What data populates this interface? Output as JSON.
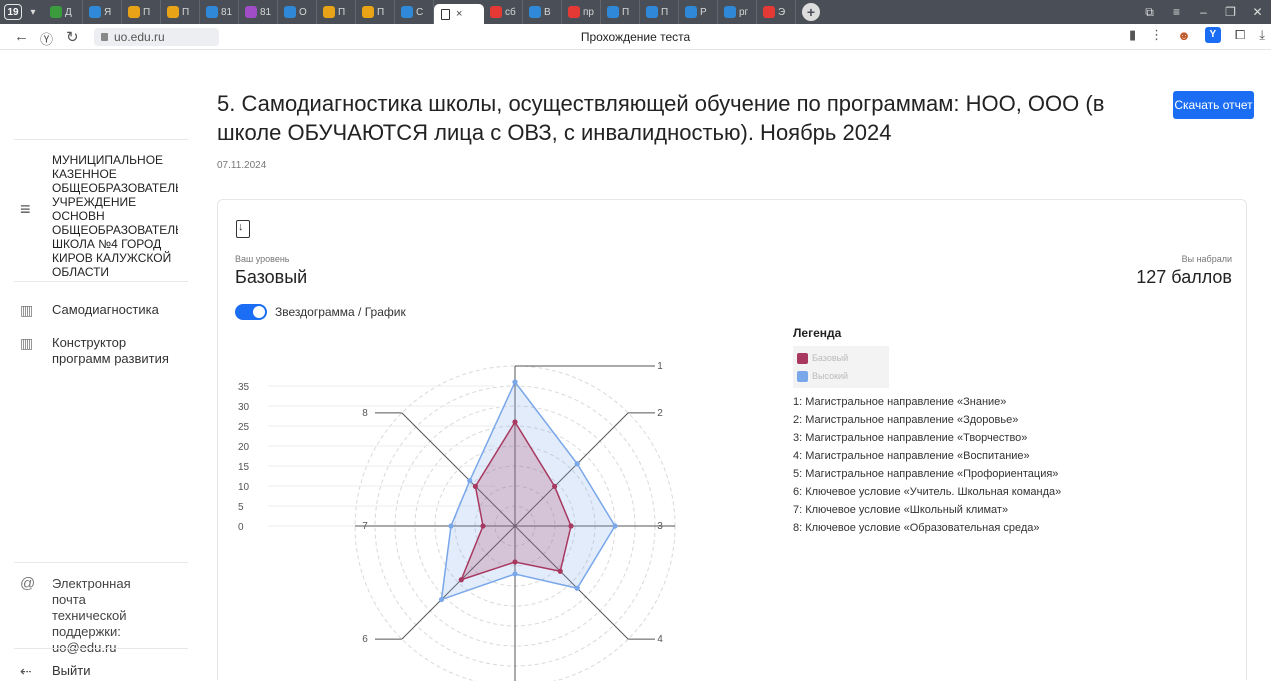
{
  "browser": {
    "tab_count": "19",
    "tabs": [
      {
        "label": "Д",
        "color": "#3a9c3d"
      },
      {
        "label": "Я",
        "color": "#2f88d8"
      },
      {
        "label": "П",
        "color": "#e8a317"
      },
      {
        "label": "П",
        "color": "#e8a317"
      },
      {
        "label": "81",
        "color": "#2f88d8"
      },
      {
        "label": "81",
        "color": "#a04dc7"
      },
      {
        "label": "О",
        "color": "#2f88d8"
      },
      {
        "label": "П",
        "color": "#e8a317"
      },
      {
        "label": "П",
        "color": "#e8a317"
      },
      {
        "label": "С",
        "color": "#2f88d8"
      }
    ],
    "tabs_after": [
      {
        "label": "сб",
        "color": "#e53935"
      },
      {
        "label": "В",
        "color": "#2f88d8"
      },
      {
        "label": "пр",
        "color": "#e53935"
      },
      {
        "label": "П",
        "color": "#2f88d8"
      },
      {
        "label": "П",
        "color": "#2f88d8"
      },
      {
        "label": "Р",
        "color": "#2f88d8"
      },
      {
        "label": "рг",
        "color": "#2f88d8"
      },
      {
        "label": "Э",
        "color": "#e53935"
      }
    ],
    "url": "uo.edu.ru",
    "page_title": "Прохождение теста"
  },
  "sidebar": {
    "org_name": "МУНИЦИПАЛЬНОЕ\nКАЗЕННОЕ\nОБЩЕОБРАЗОВАТЕЛЬН\nУЧРЕЖДЕНИЕ ОСНОВН\nОБЩЕОБРАЗОВАТЕЛЬН\nШКОЛА №4 ГОРОД\nКИРОВ КАЛУЖСКОЙ\nОБЛАСТИ",
    "nav": [
      {
        "label": "Самодиагностика"
      },
      {
        "label": "Конструктор\nпрограмм развития"
      }
    ],
    "support_text": "Электронная почта\nтехнической\nподдержки:\nuo@edu.ru",
    "logout_label": "Выйти"
  },
  "main": {
    "title": "5. Самодиагностика школы, осуществляющей обучение по программам: НОО, ООО (в школе ОБУЧАЮТСЯ лица с ОВЗ, с инвалидностью). Ноябрь 2024",
    "date": "07.11.2024",
    "download_label": "Скачать отчет",
    "level_caption": "Ваш уровень",
    "level_value": "Базовый",
    "score_caption": "Вы набрали",
    "score_value": "127 баллов",
    "toggle_label": "Звездограмма / График",
    "legend": {
      "title": "Легенда",
      "series": [
        {
          "name": "Базовый",
          "color": "#a8385f"
        },
        {
          "name": "Высокий",
          "color": "#7aa7ea"
        }
      ],
      "axes": [
        "1: Магистральное направление «Знание»",
        "2: Магистральное направление «Здоровье»",
        "3: Магистральное направление «Творчество»",
        "4: Магистральное направление «Воспитание»",
        "5: Магистральное направление «Профориентация»",
        "6: Ключевое условие «Учитель. Школьная команда»",
        "7: Ключевое условие «Школьный климат»",
        "8: Ключевое условие «Образовательная среда»"
      ]
    }
  },
  "chart_data": {
    "type": "radar",
    "categories": [
      "1",
      "2",
      "3",
      "4",
      "5",
      "6",
      "7",
      "8"
    ],
    "rmax": 40,
    "ticks": [
      0,
      5,
      10,
      15,
      20,
      25,
      30,
      35
    ],
    "series": [
      {
        "name": "Базовый",
        "color": "#a8385f",
        "values": [
          26,
          14,
          14,
          16,
          9,
          19,
          8,
          14
        ]
      },
      {
        "name": "Высокий",
        "color": "#7aa7ea",
        "values": [
          36,
          22,
          25,
          22,
          12,
          26,
          16,
          16
        ]
      }
    ]
  }
}
